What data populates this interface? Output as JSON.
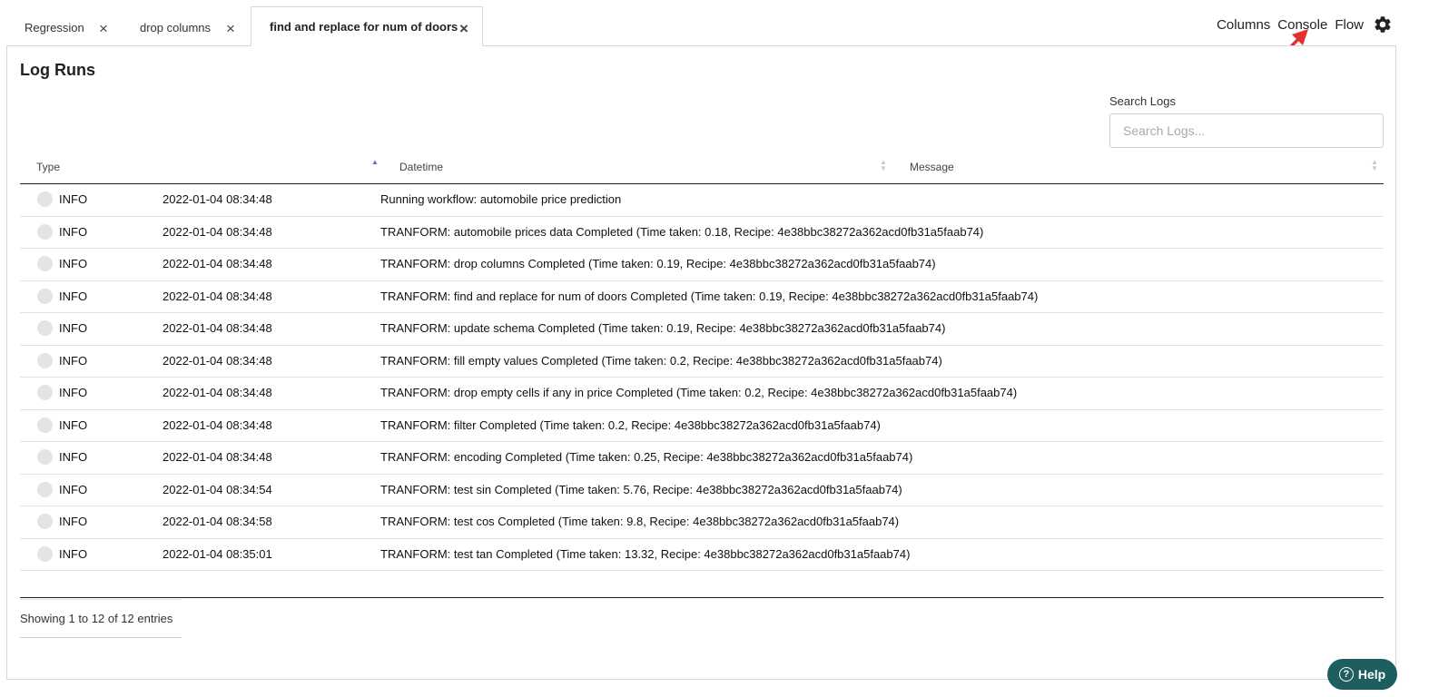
{
  "tabs": [
    {
      "label": "Regression",
      "close": "×",
      "active": false
    },
    {
      "label": "drop columns",
      "close": "×",
      "active": false
    },
    {
      "label": "find and replace for num of doors",
      "close": "×",
      "active": true
    }
  ],
  "topnav": {
    "columns": "Columns",
    "console": "Console",
    "flow": "Flow",
    "settings_icon": "gear-icon"
  },
  "panel": {
    "title": "Log Runs",
    "search": {
      "label": "Search Logs",
      "placeholder": "Search Logs...",
      "value": ""
    }
  },
  "table": {
    "columns": [
      "Type",
      "Datetime",
      "Message"
    ],
    "rows": [
      {
        "type": "INFO",
        "datetime": "2022-01-04 08:34:48",
        "message": "Running workflow: automobile price prediction"
      },
      {
        "type": "INFO",
        "datetime": "2022-01-04 08:34:48",
        "message": "TRANFORM: automobile prices data Completed (Time taken: 0.18, Recipe: 4e38bbc38272a362acd0fb31a5faab74)"
      },
      {
        "type": "INFO",
        "datetime": "2022-01-04 08:34:48",
        "message": "TRANFORM: drop columns Completed (Time taken: 0.19, Recipe: 4e38bbc38272a362acd0fb31a5faab74)"
      },
      {
        "type": "INFO",
        "datetime": "2022-01-04 08:34:48",
        "message": "TRANFORM: find and replace for num of doors Completed (Time taken: 0.19, Recipe: 4e38bbc38272a362acd0fb31a5faab74)"
      },
      {
        "type": "INFO",
        "datetime": "2022-01-04 08:34:48",
        "message": "TRANFORM: update schema Completed (Time taken: 0.19, Recipe: 4e38bbc38272a362acd0fb31a5faab74)"
      },
      {
        "type": "INFO",
        "datetime": "2022-01-04 08:34:48",
        "message": "TRANFORM: fill empty values Completed (Time taken: 0.2, Recipe: 4e38bbc38272a362acd0fb31a5faab74)"
      },
      {
        "type": "INFO",
        "datetime": "2022-01-04 08:34:48",
        "message": "TRANFORM: drop empty cells if any in price Completed (Time taken: 0.2, Recipe: 4e38bbc38272a362acd0fb31a5faab74)"
      },
      {
        "type": "INFO",
        "datetime": "2022-01-04 08:34:48",
        "message": "TRANFORM: filter Completed (Time taken: 0.2, Recipe: 4e38bbc38272a362acd0fb31a5faab74)"
      },
      {
        "type": "INFO",
        "datetime": "2022-01-04 08:34:48",
        "message": "TRANFORM: encoding Completed (Time taken: 0.25, Recipe: 4e38bbc38272a362acd0fb31a5faab74)"
      },
      {
        "type": "INFO",
        "datetime": "2022-01-04 08:34:54",
        "message": "TRANFORM: test sin Completed (Time taken: 5.76, Recipe: 4e38bbc38272a362acd0fb31a5faab74)"
      },
      {
        "type": "INFO",
        "datetime": "2022-01-04 08:34:58",
        "message": "TRANFORM: test cos Completed (Time taken: 9.8, Recipe: 4e38bbc38272a362acd0fb31a5faab74)"
      },
      {
        "type": "INFO",
        "datetime": "2022-01-04 08:35:01",
        "message": "TRANFORM: test tan Completed (Time taken: 13.32, Recipe: 4e38bbc38272a362acd0fb31a5faab74)"
      }
    ],
    "info": "Showing 1 to 12 of 12 entries"
  },
  "help": {
    "label": "Help",
    "icon": "?"
  },
  "colors": {
    "accent": "#1f5e5e",
    "sort_active": "#5b6bbd",
    "annotation": "#e53030"
  }
}
